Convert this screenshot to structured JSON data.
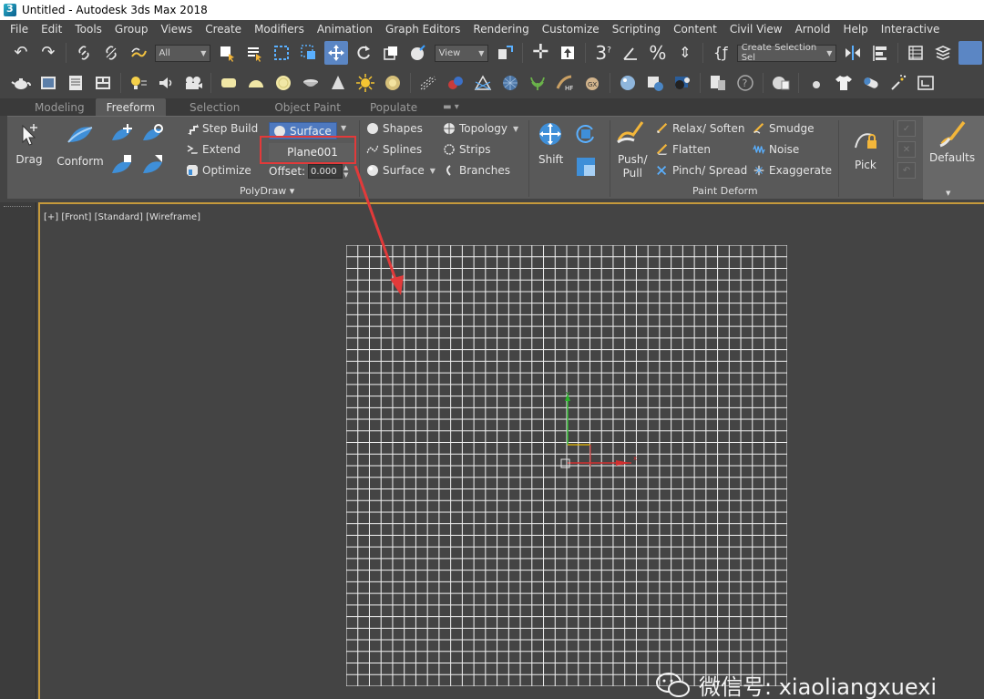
{
  "window": {
    "title": "Untitled - Autodesk 3ds Max 2018"
  },
  "menu": [
    "File",
    "Edit",
    "Tools",
    "Group",
    "Views",
    "Create",
    "Modifiers",
    "Animation",
    "Graph Editors",
    "Rendering",
    "Customize",
    "Scripting",
    "Content",
    "Civil View",
    "Arnold",
    "Help",
    "Interactive"
  ],
  "toolbar1": {
    "selection_filter": "All",
    "reference_coord": "View",
    "named_selection": "Create Selection Sel"
  },
  "ribbon_tabs": [
    "Modeling",
    "Freeform",
    "Selection",
    "Object Paint",
    "Populate"
  ],
  "ribbon_active_tab": "Freeform",
  "ribbon": {
    "drag": "Drag",
    "conform": "Conform",
    "step_build": "Step Build",
    "extend": "Extend",
    "optimize": "Optimize",
    "surface_dropdown": "Surface",
    "surface_object": "Plane001",
    "offset_label": "Offset:",
    "offset_value": "0.000",
    "shapes": "Shapes",
    "splines": "Splines",
    "surface": "Surface",
    "topology": "Topology",
    "strips": "Strips",
    "branches": "Branches",
    "polydraw_label": "PolyDraw",
    "shift": "Shift",
    "push_pull": "Push/\nPull",
    "push_line1": "Push/",
    "push_line2": "Pull",
    "relax_soften": "Relax/ Soften",
    "flatten": "Flatten",
    "pinch_spread": "Pinch/ Spread",
    "smudge": "Smudge",
    "noise": "Noise",
    "exaggerate": "Exaggerate",
    "pick": "Pick",
    "paint_deform_label": "Paint Deform",
    "defaults": "Defaults"
  },
  "viewport": {
    "label": "[+] [Front] [Standard] [Wireframe]",
    "grid_divisions": 38
  },
  "watermark": "微信号: xiaoliangxuexi",
  "colors": {
    "accent_blue": "#5b86c4",
    "viewport_border": "#c69a3c",
    "annotation_red": "#e23a3a"
  }
}
